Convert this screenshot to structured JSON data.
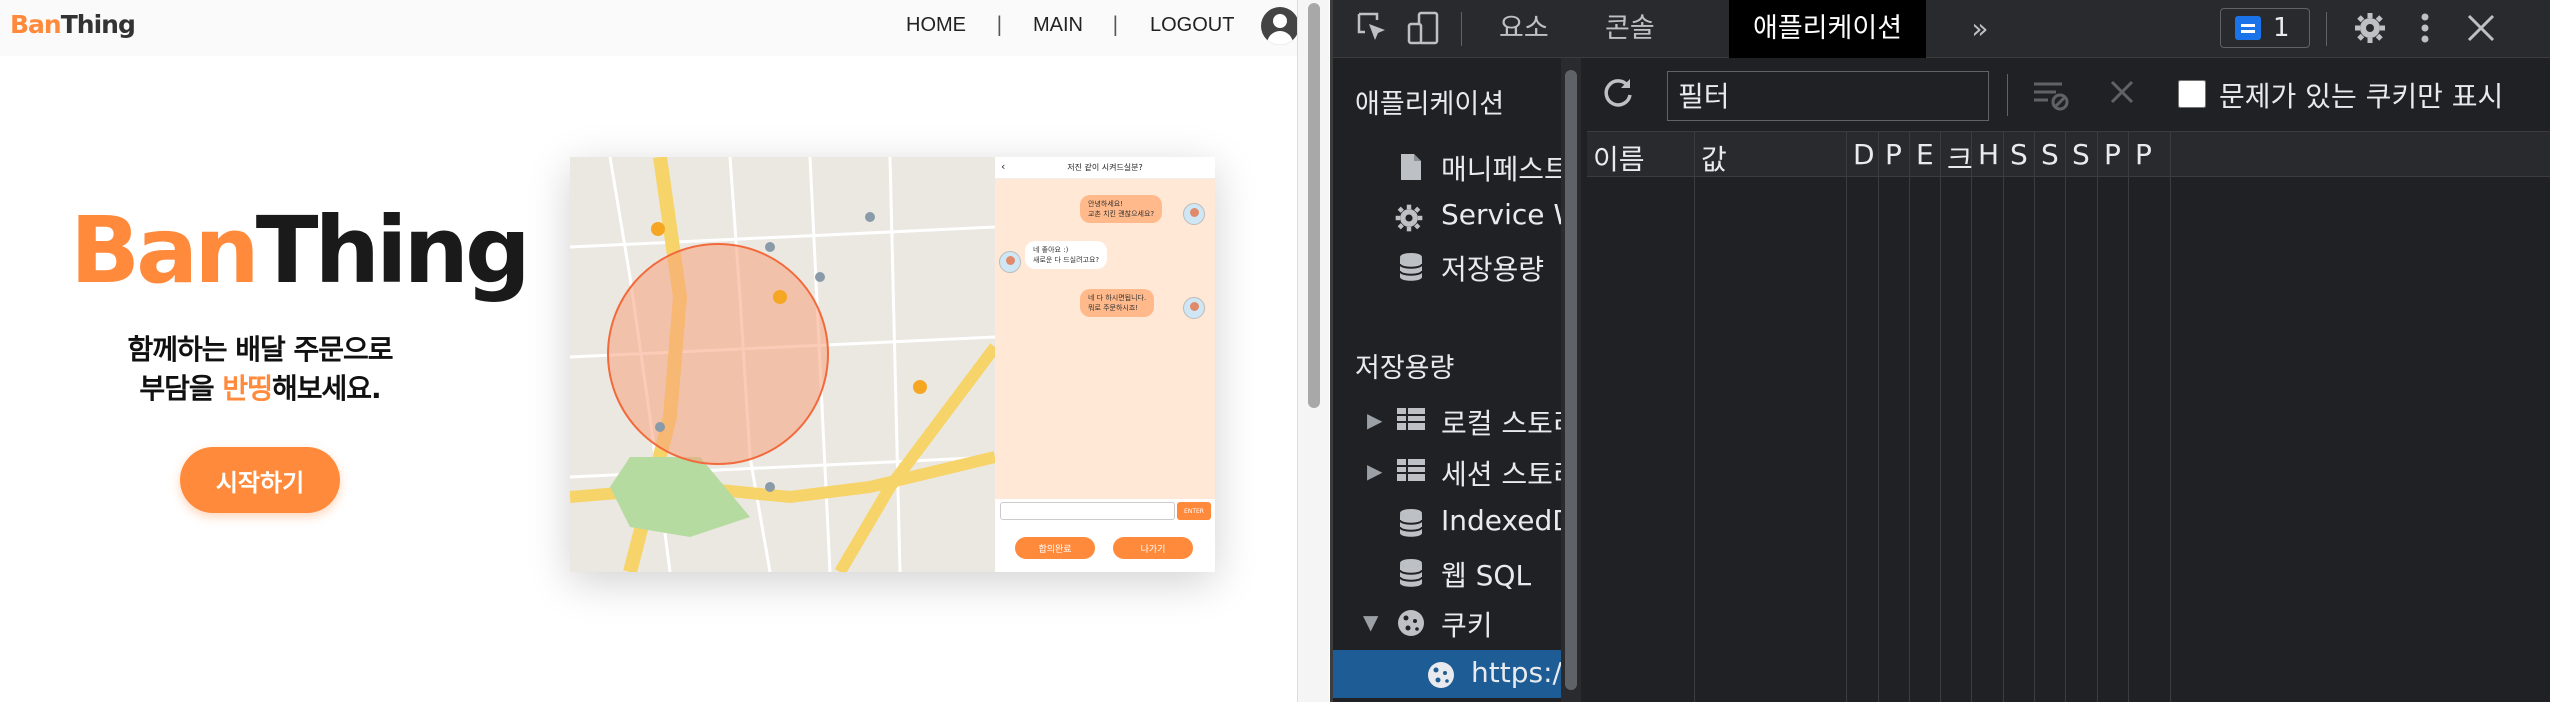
{
  "site": {
    "logo_part1": "Ban",
    "logo_part2": "Thing",
    "nav": {
      "home": "HOME",
      "main": "MAIN",
      "logout": "LOGOUT",
      "separator": "|"
    },
    "hero": {
      "logo_part1": "Ban",
      "logo_part2": "Thing",
      "tagline_line1": "함께하는 배달 주문으로",
      "tagline_line2_a": "부담을 ",
      "tagline_line2_highlight": "반띵",
      "tagline_line2_b": "해보세요.",
      "start_button": "시작하기"
    },
    "preview": {
      "chat_title": "저진 같이 시켜드실분?",
      "back": "‹",
      "messages": [
        {
          "from": "me",
          "text": "안녕하세요!\n교촌 치킨 괜찮으세요?"
        },
        {
          "from": "other",
          "text": "네 좋아요 :)\n새로운 다 드실려고요?"
        },
        {
          "from": "me",
          "text": "네 다 하시면됩니다.\n뭐로 주문하시죠!"
        }
      ],
      "enter_button": "ENTER",
      "confirm_button": "합의완료",
      "leave_button": "나가기"
    }
  },
  "devtools": {
    "tabs": [
      "요소",
      "콘솔",
      "애플리케이션"
    ],
    "active_tab": "애플리케이션",
    "more_tabs_icon": "»",
    "issues_count": "1",
    "sidebar": {
      "section_application": "애플리케이션",
      "items_application": [
        {
          "label": "매니페스트",
          "icon": "file-icon"
        },
        {
          "label": "Service Workers",
          "icon": "gear-icon"
        },
        {
          "label": "저장용량",
          "icon": "database-icon"
        }
      ],
      "section_storage": "저장용량",
      "items_storage": [
        {
          "label": "로컬 스토리지",
          "icon": "grid-icon"
        },
        {
          "label": "세션 스토리지",
          "icon": "grid-icon"
        },
        {
          "label": "IndexedDB",
          "icon": "database-icon"
        },
        {
          "label": "웹 SQL",
          "icon": "database-icon"
        },
        {
          "label": "쿠키",
          "icon": "cookie-icon"
        },
        {
          "label": "https://",
          "icon": "cookie-icon"
        }
      ]
    },
    "filter": {
      "placeholder": "필터",
      "only_issues_label": "문제가 있는 쿠키만 표시"
    },
    "columns": [
      "이름",
      "값",
      "D",
      "P",
      "E",
      "크",
      "H",
      "S",
      "S",
      "S",
      "P",
      "P"
    ],
    "colors": {
      "background": "#202124",
      "selected": "#1e5c96",
      "accent": "#ff8a3c"
    }
  }
}
